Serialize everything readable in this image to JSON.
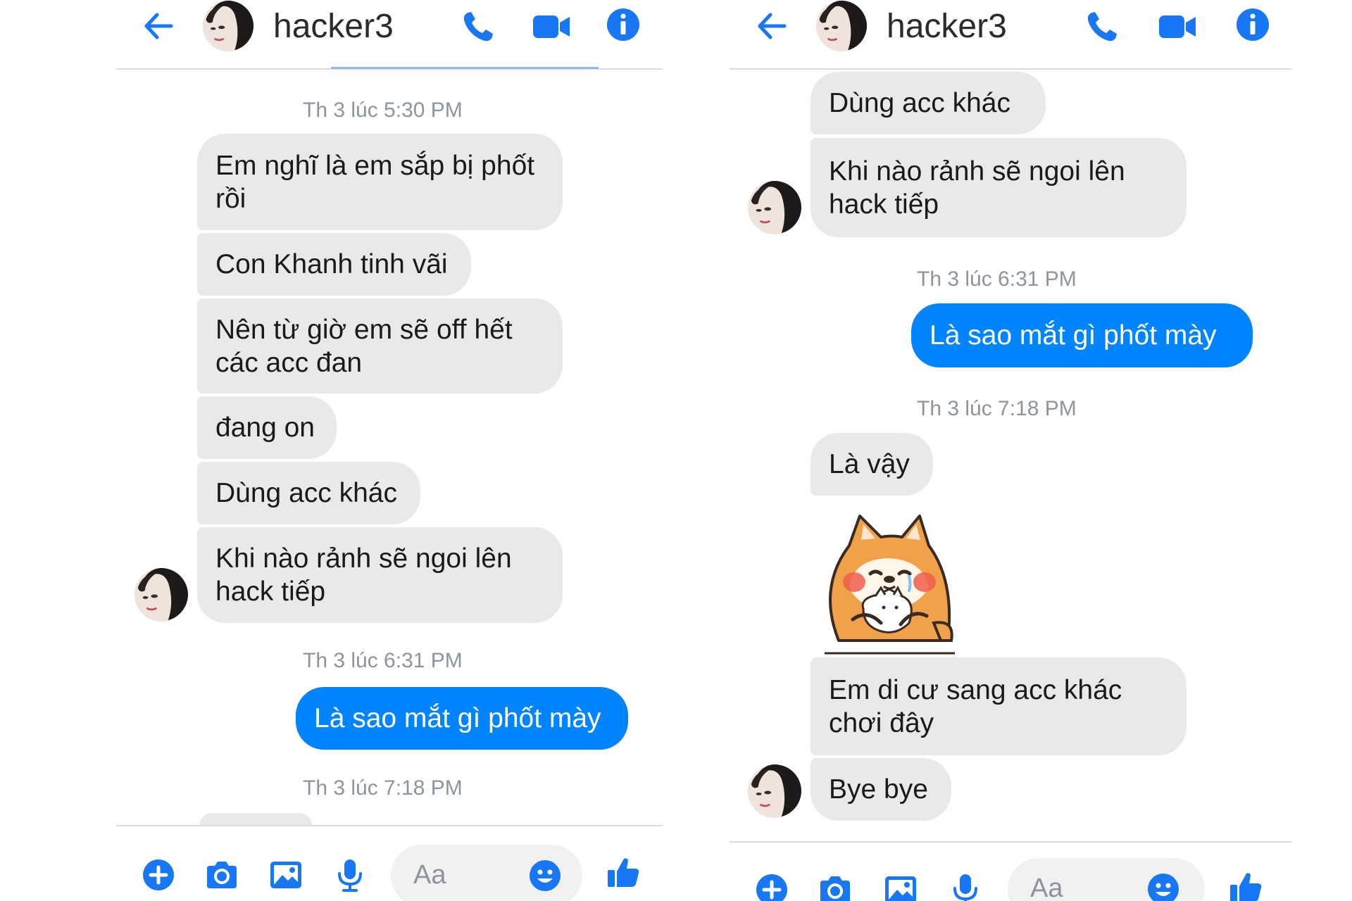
{
  "chat_name": "hacker3",
  "composer_placeholder": "Aa",
  "accent_color": "#0084ff",
  "incoming_bubble_color": "#e9e9e9",
  "icons": {
    "header": [
      "back-arrow",
      "avatar",
      "phone",
      "video-camera",
      "info"
    ],
    "composer": [
      "plus",
      "camera",
      "image",
      "microphone",
      "emoji",
      "thumbs-up"
    ]
  },
  "left": {
    "ts1": "Th 3 lúc 5:30 PM",
    "msg1": [
      "Em nghĩ là em sắp bị phốt",
      "rồi"
    ],
    "msg2": "Con Khanh tinh vãi",
    "msg3": [
      "Nên từ giờ em sẽ off hết",
      "các acc đan"
    ],
    "msg4": "đang on",
    "msg5": "Dùng acc khác",
    "msg6": [
      "Khi nào rảnh sẽ ngoi lên",
      "hack tiếp"
    ],
    "ts2": "Th 3 lúc 6:31 PM",
    "out1": "Là sao mắt gì phốt mày",
    "ts3": "Th 3 lúc 7:18 PM"
  },
  "right": {
    "msg1": "Dùng acc khác",
    "msg2": [
      "Khi nào rảnh sẽ ngoi lên",
      "hack tiếp"
    ],
    "ts1": "Th 3 lúc 6:31 PM",
    "out1": "Là sao mắt gì phốt mày",
    "ts2": "Th 3 lúc 7:18 PM",
    "msg3": "Là vậy",
    "sticker": "shiba-dog-hugging-cat-sticker",
    "msg4": [
      "Em di cư sang acc khác",
      "chơi đây"
    ],
    "msg5": "Bye bye"
  }
}
